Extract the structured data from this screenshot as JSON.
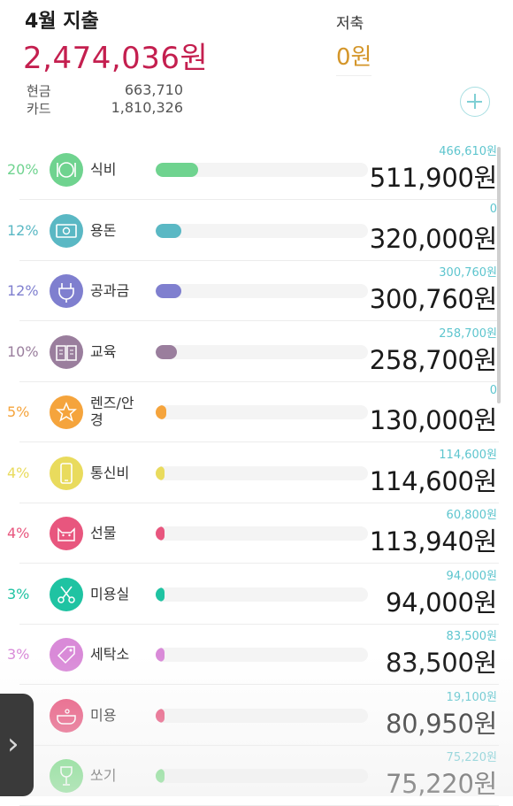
{
  "header": {
    "title": "4월 지출",
    "total": "2,474,036원",
    "payments": [
      {
        "label": "현금",
        "value": "663,710"
      },
      {
        "label": "카드",
        "value": "1,810,326"
      }
    ],
    "savings_label": "저축",
    "savings_value": "0원",
    "add_icon": "plus-circle-icon"
  },
  "categories": [
    {
      "percent": "20%",
      "name": "식비",
      "budget": "466,610원",
      "amount": "511,900원",
      "fill": 0.2,
      "color": "#6fd38f",
      "icon": "plate-cutlery-icon"
    },
    {
      "percent": "12%",
      "name": "용돈",
      "budget": "0",
      "amount": "320,000원",
      "fill": 0.12,
      "color": "#5ab8c4",
      "icon": "money-bill-icon"
    },
    {
      "percent": "12%",
      "name": "공과금",
      "budget": "300,760원",
      "amount": "300,760원",
      "fill": 0.12,
      "color": "#7f7fcf",
      "icon": "plug-icon"
    },
    {
      "percent": "10%",
      "name": "교육",
      "budget": "258,700원",
      "amount": "258,700원",
      "fill": 0.1,
      "color": "#9a7e9d",
      "icon": "book-icon"
    },
    {
      "percent": "5%",
      "name": "렌즈/안경",
      "budget": "0",
      "amount": "130,000원",
      "fill": 0.05,
      "color": "#f5a43c",
      "icon": "star-icon"
    },
    {
      "percent": "4%",
      "name": "통신비",
      "budget": "114,600원",
      "amount": "114,600원",
      "fill": 0.04,
      "color": "#e9db5d",
      "icon": "phone-icon"
    },
    {
      "percent": "4%",
      "name": "선물",
      "budget": "60,800원",
      "amount": "113,940원",
      "fill": 0.04,
      "color": "#e8567e",
      "icon": "cat-icon"
    },
    {
      "percent": "3%",
      "name": "미용실",
      "budget": "94,000원",
      "amount": "94,000원",
      "fill": 0.03,
      "color": "#1fc3a2",
      "icon": "scissors-icon"
    },
    {
      "percent": "3%",
      "name": "세탁소",
      "budget": "83,500원",
      "amount": "83,500원",
      "fill": 0.03,
      "color": "#d98ad8",
      "icon": "tag-icon"
    },
    {
      "percent": "",
      "name": "미용",
      "budget": "19,100원",
      "amount": "80,950원",
      "fill": 0.03,
      "color": "#e8567e",
      "icon": "bathtub-icon"
    },
    {
      "percent": "",
      "name": "쏘기",
      "budget": "75,220원",
      "amount": "75,220원",
      "fill": 0.03,
      "color": "#5fd66e",
      "icon": "wine-glass-icon"
    }
  ],
  "drawer_icon": "chevron-right-icon"
}
